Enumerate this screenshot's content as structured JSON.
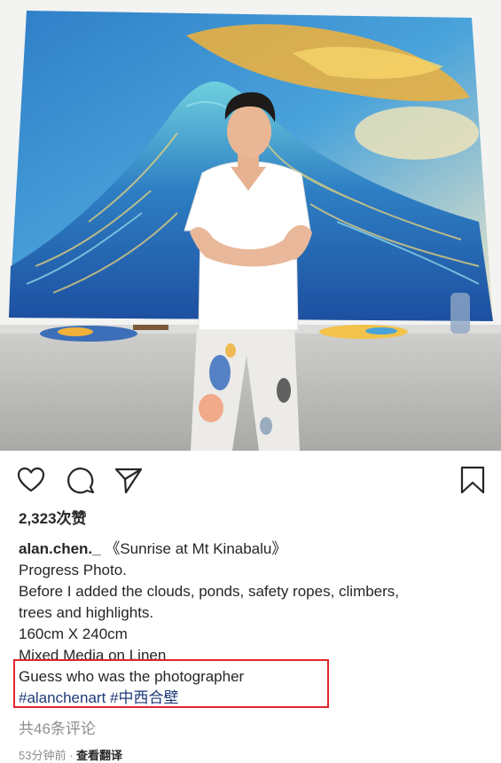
{
  "post": {
    "image_alt": "Artist standing in front of a large painting of Mt Kinabalu at sunrise",
    "likes": "2,323次赞",
    "username": "alan.chen._",
    "title": " 《Sunrise at Mt Kinabalu》",
    "caption_lines": [
      "Progress Photo.",
      "Before I added the clouds, ponds, safety ropes, climbers,",
      "trees and highlights.",
      "160cm X 240cm",
      "Mixed Media on Linen",
      "Guess who was the photographer"
    ],
    "hashtags": [
      "#alanchenart",
      "#中西合壁"
    ],
    "comments_link": "共46条评论",
    "time_ago": "53分钟前",
    "separator": " · ",
    "translate_label": "查看翻译"
  },
  "actions": {
    "like_icon": "heart-icon",
    "comment_icon": "comment-icon",
    "share_icon": "send-icon",
    "save_icon": "bookmark-icon"
  },
  "colors": {
    "text": "#262626",
    "muted": "#8e8e8e",
    "hashtag": "#1e3a78",
    "highlight": "#e1262d"
  }
}
